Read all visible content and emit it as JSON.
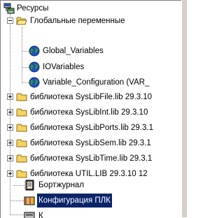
{
  "tree": {
    "root": {
      "label": "Ресурсы",
      "icon": "resources-icon"
    },
    "globals": {
      "label": "Глобальные переменные",
      "icon": "folder-open-icon",
      "children": [
        {
          "label": "Global_Variables",
          "icon": "globe-icon"
        },
        {
          "label": "IOVariables",
          "icon": "globe-icon"
        },
        {
          "label": "Variable_Configuration (VAR_",
          "icon": "globe-icon"
        }
      ]
    },
    "libraries": [
      {
        "label": "библиотека SysLibFile.lib 29.3.10"
      },
      {
        "label": "библиотека SysLibInt.lib 29.3.10"
      },
      {
        "label": "библиотека SysLibPorts.lib 29.3.1"
      },
      {
        "label": "библиотека SysLibSem.lib 29.3.1"
      },
      {
        "label": "библиотека SysLibTime.lib 29.3.1"
      },
      {
        "label": "библиотека UTIL.LIB 29.3.10 12"
      }
    ],
    "logbook": {
      "label": "Бортжурнал",
      "icon": "logbook-icon"
    },
    "plc_config": {
      "label": "Конфигурация ПЛК",
      "icon": "plc-config-icon",
      "selected": true
    },
    "next_partial": {
      "label": "К",
      "icon": "item-icon"
    }
  },
  "colors": {
    "selection": "#0a246a",
    "folder": "#f4d35e",
    "globe_blue": "#1f4fbf",
    "globe_green": "#2e9d2e"
  }
}
